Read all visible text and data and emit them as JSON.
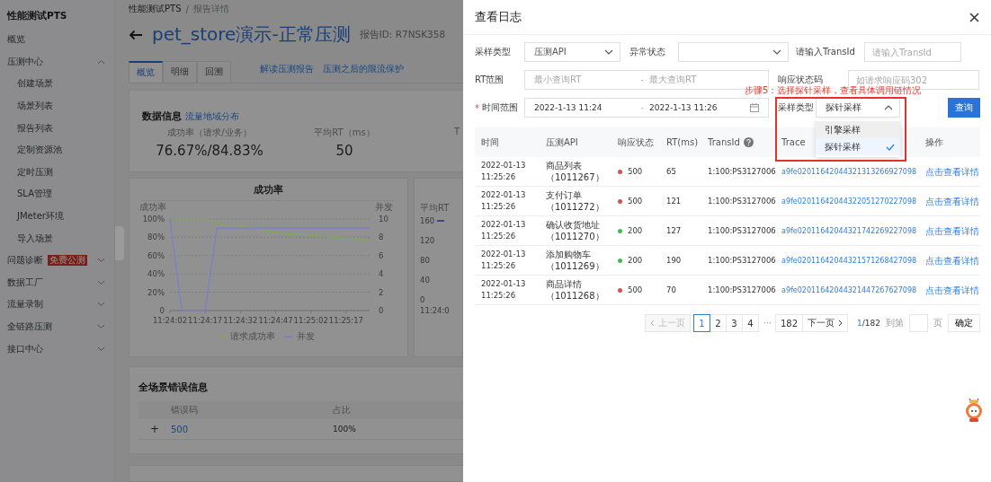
{
  "background_page": {
    "sidebar": {
      "title": "性能测试PTS",
      "items": [
        {
          "label": "概览",
          "kind": "link"
        },
        {
          "label": "压测中心",
          "kind": "group",
          "expanded": true,
          "children": [
            {
              "label": "创建场景"
            },
            {
              "label": "场景列表"
            },
            {
              "label": "报告列表"
            },
            {
              "label": "定制资源池"
            },
            {
              "label": "定时压测"
            },
            {
              "label": "SLA管理"
            },
            {
              "label": "JMeter环境"
            },
            {
              "label": "导入场景"
            }
          ]
        },
        {
          "label": "问题诊断",
          "kind": "group",
          "expanded": false,
          "badge": "免费公测"
        },
        {
          "label": "数据工厂",
          "kind": "group",
          "expanded": false
        },
        {
          "label": "流量录制",
          "kind": "group",
          "expanded": false
        },
        {
          "label": "全链路压测",
          "kind": "group",
          "expanded": false
        },
        {
          "label": "接口中心",
          "kind": "group",
          "expanded": false
        }
      ]
    },
    "breadcrumb": [
      "性能测试PTS",
      "/",
      "报告详情"
    ],
    "title": "pet_store演示-正常压测",
    "report_id": "报告ID: R7NSK358",
    "tabs": [
      {
        "label": "概览",
        "selected": true
      },
      {
        "label": "明细",
        "selected": false
      },
      {
        "label": "回溯",
        "selected": false
      }
    ],
    "links": [
      "解读压测报告",
      "压测之后的限流保护"
    ],
    "data_card": {
      "title": "数据信息",
      "link": "流量地域分布",
      "metrics": [
        {
          "label": "成功率（请求/业务）",
          "value": "76.67%/84.83%"
        },
        {
          "label": "平均RT（ms）",
          "value": "50"
        },
        {
          "label": "T"
        }
      ]
    },
    "success_chart": {
      "title": "成功率",
      "left_axis_title": "成功率",
      "right_axis_title": "并发",
      "chart_data": {
        "type": "line",
        "grid": true,
        "categories": [
          "11:24:02",
          null,
          null,
          "11:24:17",
          null,
          null,
          "11:24:32",
          null,
          null,
          "11:24:47",
          null,
          null,
          "11:25:02",
          null,
          null,
          "11:25:17",
          null,
          null
        ],
        "ylim": [
          0,
          100
        ],
        "yticks": [
          {
            "value": 0,
            "label": "0"
          },
          {
            "value": 20,
            "label": "20%"
          },
          {
            "value": 40,
            "label": "40%"
          },
          {
            "value": 60,
            "label": "60%"
          },
          {
            "value": 80,
            "label": "80%"
          },
          {
            "value": 100,
            "label": "100%"
          }
        ],
        "y2lim": [
          0,
          10
        ],
        "y2ticks": [
          0,
          2,
          4,
          6,
          8,
          10
        ],
        "series": [
          {
            "name": "请求成功率",
            "color": "#7fa85a",
            "values": [
              100,
              100,
              100,
              100,
              96,
              93,
              92,
              90,
              88,
              86,
              84,
              83,
              82,
              81,
              80,
              79,
              78,
              76
            ]
          },
          {
            "name": "并发",
            "color": "#7d7ccf",
            "axis": "y2",
            "values": [
              10,
              0,
              0,
              0,
              9,
              9,
              9,
              9,
              9,
              9,
              9,
              9,
              9,
              9,
              9,
              9,
              9,
              9
            ]
          }
        ]
      }
    },
    "rt_chart": {
      "axis_title": "平均RT",
      "yticks": [
        "160",
        "120",
        "80",
        "40",
        "0"
      ],
      "xtick": "11:24:0"
    },
    "error_card": {
      "title": "全场景错误信息",
      "columns": [
        "错误码",
        "占比"
      ],
      "rows": [
        {
          "expand": "+",
          "code": "500",
          "ratio": "100%"
        }
      ]
    }
  },
  "drawer": {
    "title": "查看日志",
    "row1": [
      {
        "label": "采样类型",
        "kind": "select",
        "value": "压测API"
      },
      {
        "label": "异常状态",
        "kind": "select"
      },
      {
        "label": "请输入TransId",
        "kind": "input",
        "placeholder": "请输入TransId"
      }
    ],
    "row2": [
      {
        "label": "RT范围",
        "kind": "range",
        "placeholder_from": "最小查询RT",
        "separator": "-",
        "placeholder_to": "最大查询RT"
      },
      {
        "label": "响应状态码",
        "kind": "input",
        "placeholder": "如请求响应码302"
      }
    ],
    "time_range": {
      "required_mark": "*",
      "label": "时间范围",
      "from": "2022-1-13 11:24",
      "separator": "-",
      "to": "2022-1-13 11:26"
    },
    "sample_select": {
      "label": "采样类型",
      "value": "探针采样",
      "open": true,
      "options": [
        {
          "label": "引擎采样",
          "selected": false,
          "hovered": true
        },
        {
          "label": "探针采样",
          "selected": true,
          "hovered": false
        }
      ]
    },
    "query_button": "查询",
    "annotation": "步骤5：选择探针采样，查看具体调用链情况",
    "columns": [
      {
        "label": "时间",
        "help": false
      },
      {
        "label": "压测API",
        "help": false
      },
      {
        "label": "响应状态",
        "help": false
      },
      {
        "label": "RT(ms)",
        "help": false
      },
      {
        "label": "TransId",
        "help": true
      },
      {
        "label": "Trace",
        "help": false
      },
      {
        "label": "操作",
        "help": false
      }
    ],
    "rows": [
      {
        "time": "2022-01-13 11:25:26",
        "api": "商品列表（1011267）",
        "color": "#e5484d",
        "status": "500",
        "rt": "65",
        "trans_id": "1:100:PS3127006",
        "trace": "a9fe02011642044321313266927098",
        "action": "点击查看详情"
      },
      {
        "time": "2022-01-13 11:25:26",
        "api": "支付订单（1011272）",
        "color": "#e5484d",
        "status": "500",
        "rt": "121",
        "trans_id": "1:100:PS3127006",
        "trace": "a9fe02011642044322051270227098",
        "action": "点击查看详情"
      },
      {
        "time": "2022-01-13 11:25:26",
        "api": "确认收货地址（1011270）",
        "color": "#3dbd4a",
        "status": "200",
        "rt": "127",
        "trans_id": "1:100:PS3127006",
        "trace": "a9fe02011642044321742269227098",
        "action": "点击查看详情"
      },
      {
        "time": "2022-01-13 11:25:26",
        "api": "添加购物车（1011269）",
        "color": "#3dbd4a",
        "status": "200",
        "rt": "190",
        "trans_id": "1:100:PS3127006",
        "trace": "a9fe02011642044321571268427098",
        "action": "点击查看详情"
      },
      {
        "time": "2022-01-13 11:25:26",
        "api": "商品详情（1011268）",
        "color": "#e5484d",
        "status": "500",
        "rt": "70",
        "trans_id": "1:100:PS3127006",
        "trace": "a9fe02011642044321447267627098",
        "action": "点击查看详情"
      }
    ],
    "pagination": [
      {
        "label": "上一页",
        "kind": "prev",
        "disabled": true
      },
      {
        "label": "1",
        "kind": "page",
        "selected": true
      },
      {
        "label": "2",
        "kind": "page",
        "selected": false
      },
      {
        "label": "3",
        "kind": "page",
        "selected": false
      },
      {
        "label": "4",
        "kind": "page",
        "selected": false
      },
      {
        "label": "···",
        "kind": "ellipsis"
      },
      {
        "label": "182",
        "kind": "page",
        "selected": false
      },
      {
        "label": "下一页",
        "kind": "next",
        "disabled": false
      }
    ],
    "page_current": "1",
    "page_rest": "/182",
    "goto_label": "到第",
    "goto_suffix": "页",
    "confirm_button": "确定"
  }
}
